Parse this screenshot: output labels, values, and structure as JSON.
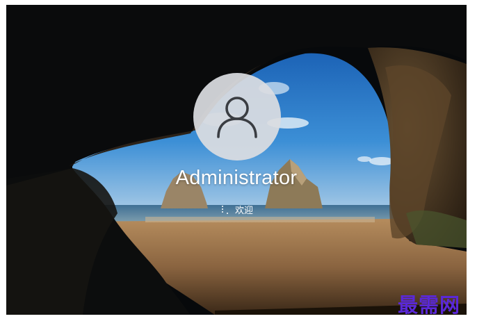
{
  "lock_screen": {
    "user_name": "Administrator",
    "status_text": "欢迎"
  },
  "watermark": {
    "text": "最需网",
    "color": "#5a28d8"
  },
  "icons": {
    "avatar": "user-silhouette-icon",
    "loading": "loading-spinner-icon"
  },
  "colors": {
    "avatar_bg": "#dadde1",
    "text": "#ffffff"
  }
}
